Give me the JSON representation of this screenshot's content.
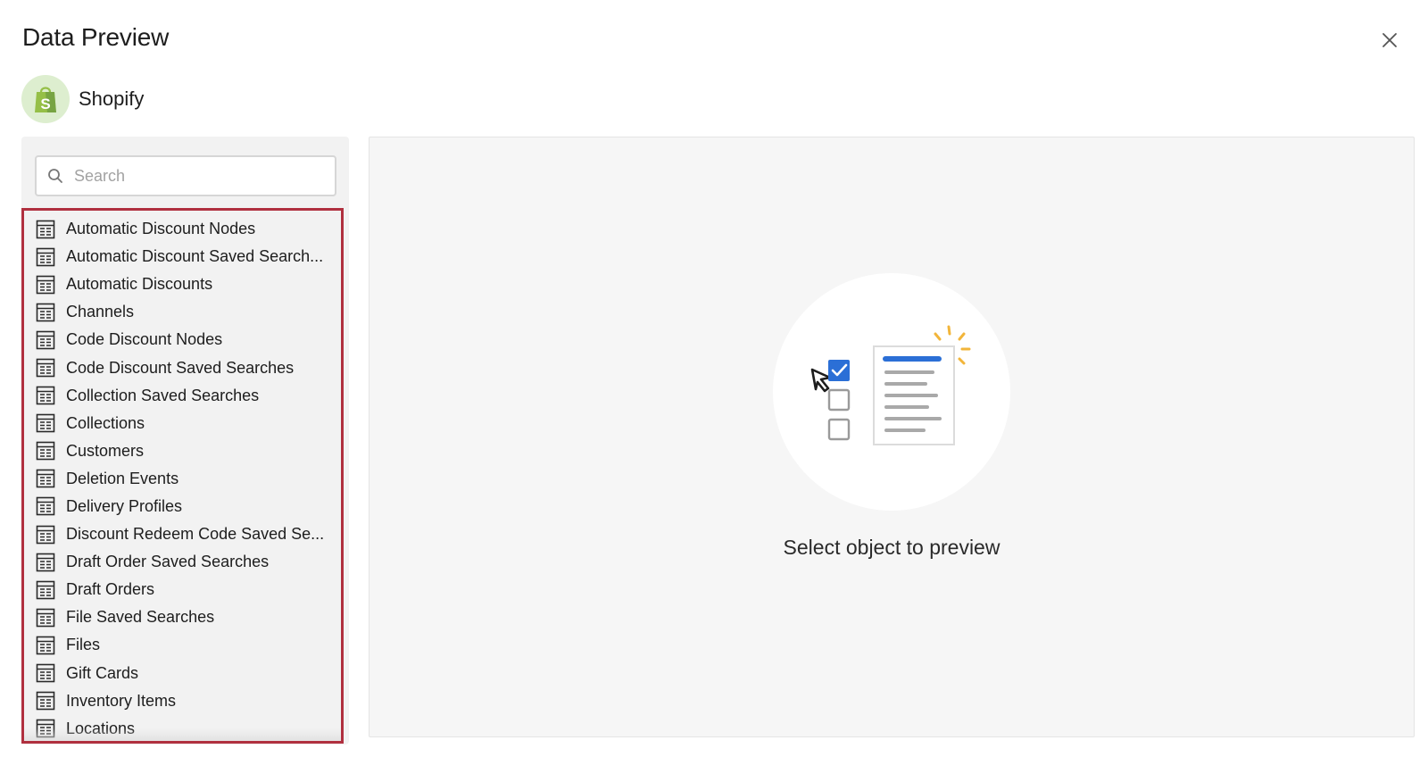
{
  "dialog": {
    "title": "Data Preview"
  },
  "source": {
    "name": "Shopify",
    "logo_letter": "S"
  },
  "search": {
    "placeholder": "Search"
  },
  "objects": [
    "Automatic Discount Nodes",
    "Automatic Discount Saved Search...",
    "Automatic Discounts",
    "Channels",
    "Code Discount Nodes",
    "Code Discount Saved Searches",
    "Collection Saved Searches",
    "Collections",
    "Customers",
    "Deletion Events",
    "Delivery Profiles",
    "Discount Redeem Code Saved Se...",
    "Draft Order Saved Searches",
    "Draft Orders",
    "File Saved Searches",
    "Files",
    "Gift Cards",
    "Inventory Items",
    "Locations"
  ],
  "preview": {
    "empty_message": "Select object to preview"
  },
  "colors": {
    "list_highlight_border": "#b0303f",
    "accent_blue": "#2b6fd6",
    "spark_yellow": "#f2b53a",
    "shopify_green": "#95bf47"
  }
}
